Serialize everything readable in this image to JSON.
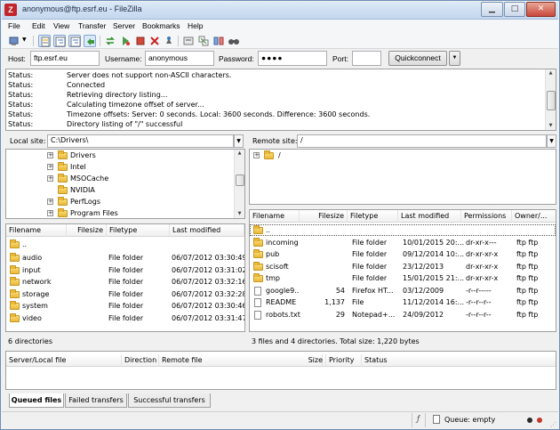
{
  "window": {
    "title": "anonymous@ftp.esrf.eu - FileZilla",
    "app_icon": "filezilla-icon",
    "controls": [
      "minimize",
      "maximize",
      "close"
    ]
  },
  "menu": [
    "File",
    "Edit",
    "View",
    "Transfer",
    "Server",
    "Bookmarks",
    "Help"
  ],
  "quickconnect": {
    "host_label": "Host:",
    "host_value": "ftp.esrf.eu",
    "username_label": "Username:",
    "username_value": "anonymous",
    "password_label": "Password:",
    "password_value": "●●●●",
    "port_label": "Port:",
    "port_value": "",
    "button_label": "Quickconnect"
  },
  "log": [
    {
      "k": "Status:",
      "v": "Server does not support non-ASCII characters."
    },
    {
      "k": "Status:",
      "v": "Connected"
    },
    {
      "k": "Status:",
      "v": "Retrieving directory listing..."
    },
    {
      "k": "Status:",
      "v": "Calculating timezone offset of server..."
    },
    {
      "k": "Status:",
      "v": "Timezone offsets: Server: 0 seconds. Local: 3600 seconds. Difference: 3600 seconds."
    },
    {
      "k": "Status:",
      "v": "Directory listing of \"/\" successful"
    }
  ],
  "local": {
    "site_label": "Local site:",
    "site_path": "C:\\Drivers\\",
    "tree": [
      "Drivers",
      "Intel",
      "MSOCache",
      "NVIDIA",
      "PerfLogs",
      "Program Files"
    ],
    "headers": {
      "name": "Filename",
      "size": "Filesize",
      "type": "Filetype",
      "modified": "Last modified"
    },
    "files": [
      {
        "name": "..",
        "size": "",
        "type": "",
        "modified": ""
      },
      {
        "name": "audio",
        "size": "",
        "type": "File folder",
        "modified": "06/07/2012 03:30:49"
      },
      {
        "name": "input",
        "size": "",
        "type": "File folder",
        "modified": "06/07/2012 03:31:02"
      },
      {
        "name": "network",
        "size": "",
        "type": "File folder",
        "modified": "06/07/2012 03:32:16"
      },
      {
        "name": "storage",
        "size": "",
        "type": "File folder",
        "modified": "06/07/2012 03:32:28"
      },
      {
        "name": "system",
        "size": "",
        "type": "File folder",
        "modified": "06/07/2012 03:30:46"
      },
      {
        "name": "video",
        "size": "",
        "type": "File folder",
        "modified": "06/07/2012 03:31:47"
      }
    ],
    "status": "6 directories"
  },
  "remote": {
    "site_label": "Remote site:",
    "site_path": "/",
    "tree_root": "/",
    "headers": {
      "name": "Filename",
      "size": "Filesize",
      "type": "Filetype",
      "modified": "Last modified",
      "perms": "Permissions",
      "owner": "Owner/..."
    },
    "files": [
      {
        "name": "..",
        "size": "",
        "type": "",
        "modified": "",
        "perms": "",
        "owner": "",
        "kind": "folder"
      },
      {
        "name": "incoming",
        "size": "",
        "type": "File folder",
        "modified": "10/01/2015 20:...",
        "perms": "dr-xr-x---",
        "owner": "ftp ftp",
        "kind": "folder"
      },
      {
        "name": "pub",
        "size": "",
        "type": "File folder",
        "modified": "09/12/2014 10:...",
        "perms": "dr-xr-xr-x",
        "owner": "ftp ftp",
        "kind": "folder"
      },
      {
        "name": "scisoft",
        "size": "",
        "type": "File folder",
        "modified": "23/12/2013",
        "perms": "dr-xr-xr-x",
        "owner": "ftp ftp",
        "kind": "folder"
      },
      {
        "name": "tmp",
        "size": "",
        "type": "File folder",
        "modified": "15/01/2015 21:...",
        "perms": "dr-xr-xr-x",
        "owner": "ftp ftp",
        "kind": "folder"
      },
      {
        "name": "google9...",
        "size": "54",
        "type": "Firefox HT...",
        "modified": "03/12/2009",
        "perms": "-r--r-----",
        "owner": "ftp ftp",
        "kind": "file"
      },
      {
        "name": "README",
        "size": "1,137",
        "type": "File",
        "modified": "11/12/2014 16:...",
        "perms": "-r--r--r--",
        "owner": "ftp ftp",
        "kind": "file"
      },
      {
        "name": "robots.txt",
        "size": "29",
        "type": "Notepad+...",
        "modified": "24/09/2012",
        "perms": "-r--r--r--",
        "owner": "ftp ftp",
        "kind": "file"
      }
    ],
    "status": "3 files and 4 directories. Total size: 1,220 bytes"
  },
  "queue": {
    "headers": {
      "file": "Server/Local file",
      "direction": "Direction",
      "remote": "Remote file",
      "size": "Size",
      "priority": "Priority",
      "status": "Status"
    },
    "tabs": [
      "Queued files",
      "Failed transfers",
      "Successful transfers"
    ]
  },
  "statusbar": {
    "queue_text": "Queue: empty"
  }
}
